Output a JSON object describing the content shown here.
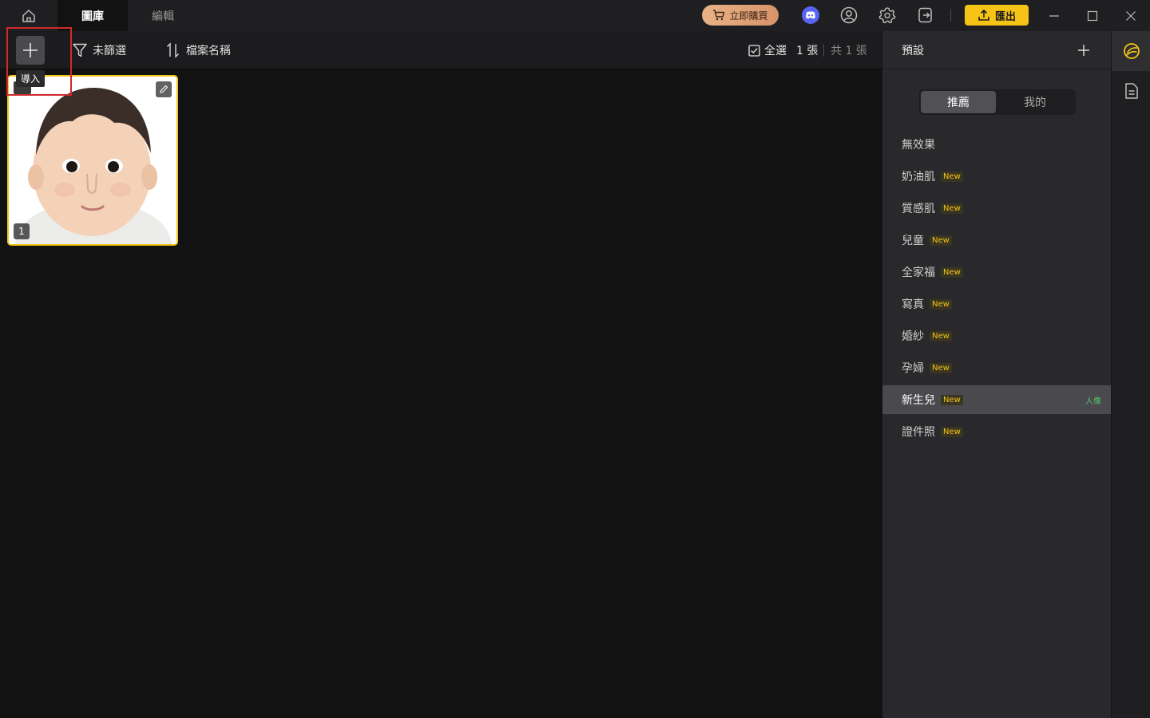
{
  "tabs": {
    "gallery": "圖庫",
    "edit": "編輯"
  },
  "titlebar": {
    "buy_label": "立即購買",
    "export_label": "匯出"
  },
  "toolbar": {
    "import_tooltip": "導入",
    "filter_label": "未篩選",
    "sort_label": "檔案名稱",
    "select_all_label": "全選",
    "selected_count": "1 張",
    "total_count": "共 1 張"
  },
  "thumbnail": {
    "index": "1"
  },
  "panel": {
    "title": "預設",
    "seg_recommended": "推薦",
    "seg_mine": "我的",
    "presets": [
      {
        "name": "無效果",
        "badge": ""
      },
      {
        "name": "奶油肌",
        "badge": "New"
      },
      {
        "name": "質感肌",
        "badge": "New"
      },
      {
        "name": "兒童",
        "badge": "New"
      },
      {
        "name": "全家福",
        "badge": "New"
      },
      {
        "name": "寫真",
        "badge": "New"
      },
      {
        "name": "婚紗",
        "badge": "New"
      },
      {
        "name": "孕婦",
        "badge": "New"
      },
      {
        "name": "新生兒",
        "badge": "New",
        "tag": "人像",
        "active": true
      },
      {
        "name": "證件照",
        "badge": "New"
      }
    ]
  },
  "colors": {
    "accent": "#f6c417",
    "selected_border": "#f0c419",
    "highlight": "#d12a2a",
    "tag_green": "#52c26b"
  },
  "icons": [
    "home-icon",
    "cart-icon",
    "discord-icon",
    "account-icon",
    "settings-icon",
    "sign-out-icon",
    "upload-icon",
    "minimize-icon",
    "maximize-icon",
    "close-icon",
    "plus-icon",
    "filter-icon",
    "sort-icon",
    "checkbox-icon",
    "pencil-icon",
    "presets-icon",
    "document-icon"
  ]
}
